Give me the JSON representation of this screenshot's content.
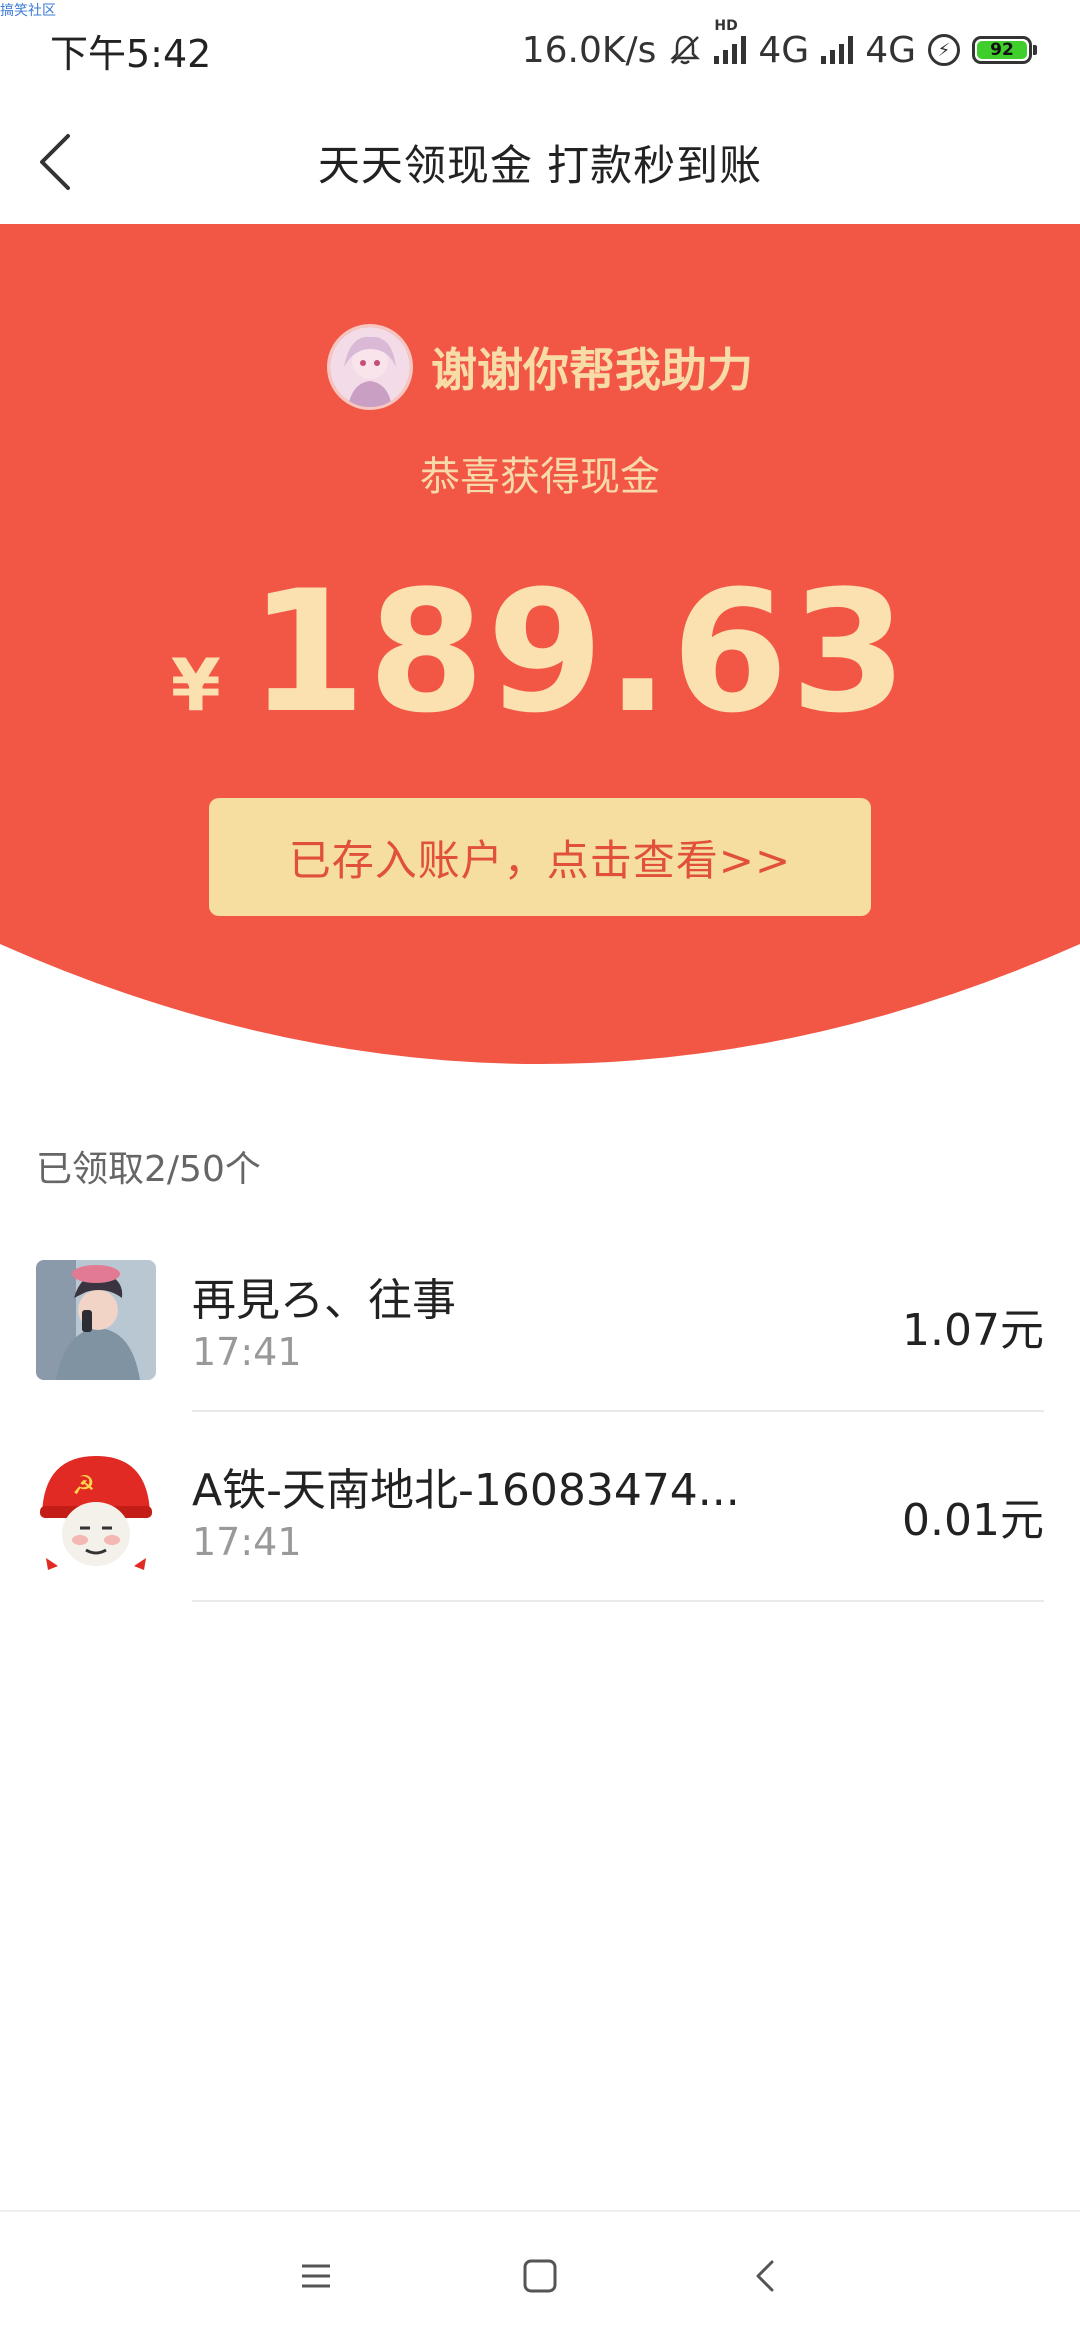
{
  "watermark": "搞笑社区",
  "status_bar": {
    "time": "下午5:42",
    "net_speed": "16.0K/s",
    "hd_label": "HD",
    "net1": "4G",
    "net2": "4G",
    "battery": "92",
    "icons": [
      "mute-bell-icon",
      "signal-icon",
      "signal-icon",
      "charging-icon",
      "battery-icon"
    ]
  },
  "nav": {
    "title": "天天领现金 打款秒到账",
    "back_icon": "chevron-left-icon"
  },
  "hero": {
    "helper_text": "谢谢你帮我助力",
    "congrats_text": "恭喜获得现金",
    "currency": "¥",
    "amount": "189.63",
    "view_button": "已存入账户，点击查看>>",
    "colors": {
      "background": "#f25746",
      "gold_text": "#fbe0b0",
      "button": "#f5dea0",
      "button_text": "#e0503c"
    }
  },
  "claimed": {
    "label": "已领取2/50个"
  },
  "records": [
    {
      "name": "再見ろ、往事",
      "time": "17:41",
      "amount": "1.07元",
      "avatar": "boy-avatar"
    },
    {
      "name": "A铁-天南地北-16083474...",
      "time": "17:41",
      "amount": "0.01元",
      "avatar": "meme-avatar"
    }
  ],
  "system_nav": {
    "icons": [
      "menu-icon",
      "home-square-icon",
      "back-triangle-icon"
    ]
  }
}
